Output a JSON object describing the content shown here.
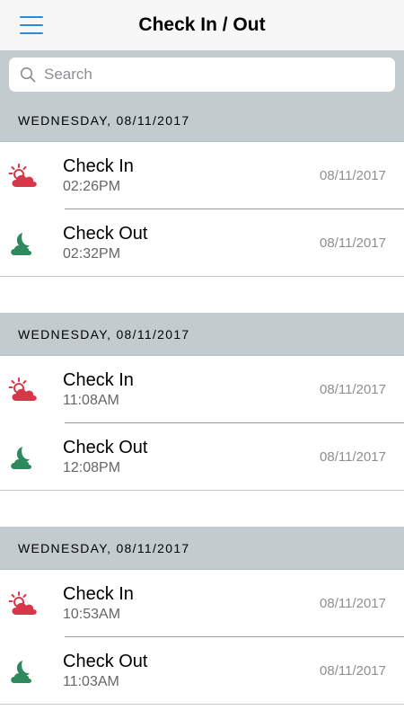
{
  "header": {
    "title": "Check In / Out"
  },
  "search": {
    "placeholder": "Search"
  },
  "colors": {
    "checkin": "#d8374a",
    "checkout": "#2e8a5c",
    "accent": "#2d8bd8"
  },
  "sections": [
    {
      "header": "WEDNESDAY, 08/11/2017",
      "items": [
        {
          "label": "Check In",
          "time": "02:26PM",
          "date": "08/11/2017",
          "icon": "sun-cloud-icon"
        },
        {
          "label": "Check Out",
          "time": "02:32PM",
          "date": "08/11/2017",
          "icon": "moon-cloud-icon"
        }
      ]
    },
    {
      "header": "WEDNESDAY, 08/11/2017",
      "items": [
        {
          "label": "Check In",
          "time": "11:08AM",
          "date": "08/11/2017",
          "icon": "sun-cloud-icon"
        },
        {
          "label": "Check Out",
          "time": "12:08PM",
          "date": "08/11/2017",
          "icon": "moon-cloud-icon"
        }
      ]
    },
    {
      "header": "WEDNESDAY, 08/11/2017",
      "items": [
        {
          "label": "Check In",
          "time": "10:53AM",
          "date": "08/11/2017",
          "icon": "sun-cloud-icon"
        },
        {
          "label": "Check Out",
          "time": "11:03AM",
          "date": "08/11/2017",
          "icon": "moon-cloud-icon"
        }
      ]
    }
  ]
}
